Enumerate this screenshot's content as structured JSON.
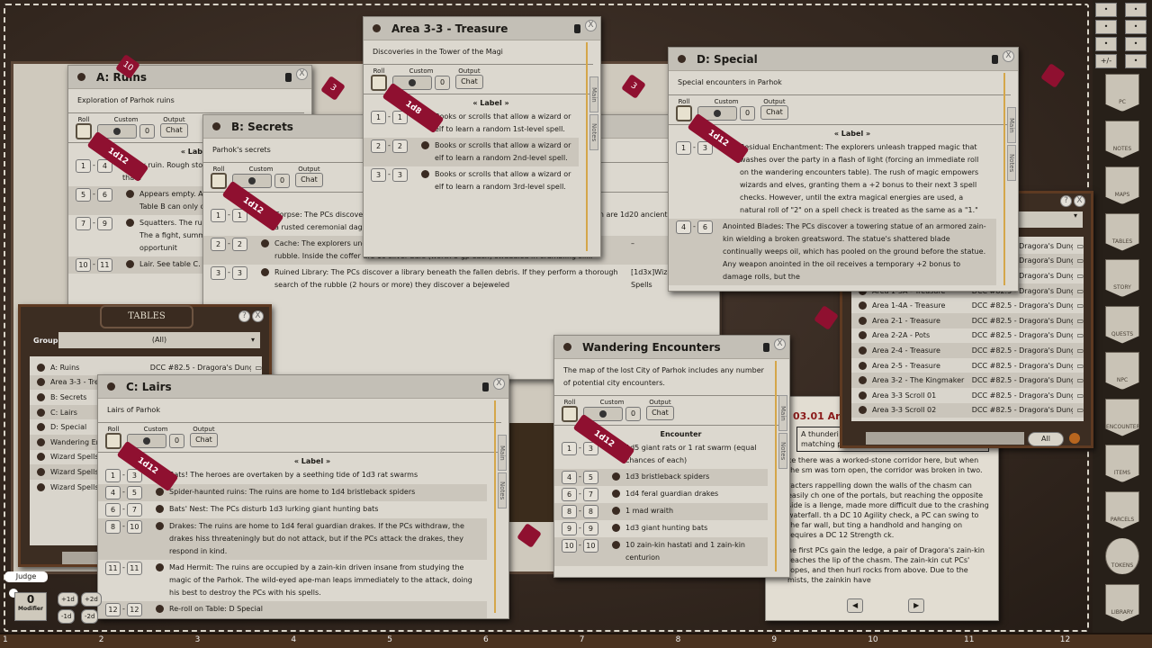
{
  "bottombar": {
    "ticks": [
      "1",
      "2",
      "3",
      "4",
      "5",
      "6",
      "7",
      "8",
      "9",
      "10",
      "11",
      "12"
    ]
  },
  "windows": [
    {
      "id": "a-ruins",
      "title": "A: Ruins",
      "subtitle": "Exploration of Parhok ruins",
      "roll": "Roll",
      "custom": "Custom",
      "custom_value": "0",
      "output": "Output",
      "output_value": "Chat",
      "dice": "1d12",
      "column": "« Label »",
      "tabs": [],
      "rows": [
        {
          "from": "1",
          "to": "4",
          "dot": false,
          "text": "Empty ruin. Rough stone and plaster are all that r"
        },
        {
          "from": "5",
          "to": "6",
          "dot": true,
          "text": "Appears empty. A c otherwise. See tabl Table B can only oc"
        },
        {
          "from": "7",
          "to": "9",
          "dot": true,
          "text": "Squatters. The ruin zain-kin hastati. The a fight, summoning the first opportunit"
        },
        {
          "from": "10",
          "to": "11",
          "dot": true,
          "text": "Lair. See table C."
        }
      ]
    },
    {
      "id": "b-secrets",
      "title": "B: Secrets",
      "subtitle": "Parhok's secrets",
      "roll": "Roll",
      "custom": "Custom",
      "custom_value": "0",
      "output": "Output",
      "output_value": "Chat",
      "dice": "1d12",
      "column": "Encounter",
      "tabs": [],
      "rows": [
        {
          "from": "1",
          "to": "1",
          "dot": true,
          "text": "Corpse: The PCs discover th of a Parhok enchanter. The tattered robes of its order. skeleton are 1d20 ancient g and a rusted ceremonial dagger."
        },
        {
          "from": "2",
          "to": "2",
          "dot": true,
          "text": "Cache: The explorers uncover a locked coffer (DC 15 Open Locks check) buried amid the rubble. Inside the coffer are 10 silver bars (worth 5 gp each) swaddled in crumbling silk.",
          "extra": "–"
        },
        {
          "from": "3",
          "to": "3",
          "dot": true,
          "text": "Ruined Library: The PCs discover a library beneath the fallen debris. If they perform a thorough search of the rubble (2 hours or more) they discover a bejeweled",
          "extra": "[1d3x]Wizard Spells"
        }
      ]
    },
    {
      "id": "area-3-3",
      "title": "Area 3-3 - Treasure",
      "subtitle": "Discoveries in the Tower of the Magi",
      "roll": "Roll",
      "custom": "Custom",
      "custom_value": "0",
      "output": "Output",
      "output_value": "Chat",
      "dice": "1d8",
      "column": "« Label »",
      "tabs": [
        "Main",
        "Notes"
      ],
      "rows": [
        {
          "from": "1",
          "to": "1",
          "dot": true,
          "text": "Books or scrolls that allow a wizard or elf to learn a random 1st-level spell."
        },
        {
          "from": "2",
          "to": "2",
          "dot": true,
          "text": "Books or scrolls that allow a wizard or elf to learn a random 2nd-level spell."
        },
        {
          "from": "3",
          "to": "3",
          "dot": true,
          "text": "Books or scrolls that allow a wizard or elf to learn a random 3rd-level spell."
        }
      ]
    },
    {
      "id": "d-special",
      "title": "D: Special",
      "subtitle": "Special encounters in Parhok",
      "roll": "Roll",
      "custom": "Custom",
      "custom_value": "0",
      "output": "Output",
      "output_value": "Chat",
      "dice": "1d12",
      "column": "« Label »",
      "tabs": [
        "Main",
        "Notes"
      ],
      "rows": [
        {
          "from": "1",
          "to": "3",
          "dot": true,
          "text": "Residual Enchantment: The explorers unleash trapped magic that washes over the party in a flash of light (forcing an immediate roll on the wandering encounters table). The rush of magic empowers wizards and elves, granting them a +2 bonus to their next 3 spell checks. However, until the extra magical energies are used, a natural roll of \"2\" on a spell check is treated as the same as a \"1.\""
        },
        {
          "from": "4",
          "to": "6",
          "dot": false,
          "text": "Anointed Blades: The PCs discover a towering statue of an armored zain-kin wielding a broken greatsword. The statue's shattered blade continually weeps oil, which has pooled on the ground before the statue. Any weapon anointed in the oil receives a temporary +2 bonus to damage rolls, but the"
        }
      ]
    },
    {
      "id": "c-lairs",
      "title": "C: Lairs",
      "subtitle": "Lairs of Parhok",
      "roll": "Roll",
      "custom": "Custom",
      "custom_value": "0",
      "output": "Output",
      "output_value": "Chat",
      "dice": "1d12",
      "column": "« Label »",
      "tabs": [
        "Main",
        "Notes"
      ],
      "rows": [
        {
          "from": "1",
          "to": "3",
          "dot": true,
          "text": "Rats! The heroes are overtaken by a seething tide of 1d3 rat swarms"
        },
        {
          "from": "4",
          "to": "5",
          "dot": true,
          "text": "Spider-haunted ruins: The ruins are home to 1d4 bristleback spiders"
        },
        {
          "from": "6",
          "to": "7",
          "dot": true,
          "text": "Bats' Nest: The PCs disturb 1d3 lurking giant hunting bats"
        },
        {
          "from": "8",
          "to": "10",
          "dot": true,
          "text": "Drakes: The ruins are home to 1d4 feral guardian drakes. If the PCs withdraw, the drakes hiss threateningly but do not attack, but if the PCs attack the drakes, they respond in kind."
        },
        {
          "from": "11",
          "to": "11",
          "dot": true,
          "text": "Mad Hermit: The ruins are occupied by a zain-kin driven insane from studying the magic of the Parhok. The wild-eyed ape-man leaps immediately to the attack, doing his best to destroy the PCs with his spells."
        },
        {
          "from": "12",
          "to": "12",
          "dot": true,
          "text": "Re-roll on Table: D Special"
        }
      ]
    },
    {
      "id": "wandering",
      "title": "Wandering Encounters",
      "subtitle": "The map of the lost City of Parhok includes any number of potential city encounters.",
      "roll": "Roll",
      "custom": "Custom",
      "custom_value": "0",
      "output": "Output",
      "output_value": "Chat",
      "dice": "1d12",
      "column": "Encounter",
      "tabs": [
        "Main",
        "Notes"
      ],
      "rows": [
        {
          "from": "1",
          "to": "3",
          "dot": true,
          "text": "1d5 giant rats or 1 rat swarm (equal chances of each)"
        },
        {
          "from": "4",
          "to": "5",
          "dot": true,
          "text": "1d3 bristleback spiders"
        },
        {
          "from": "6",
          "to": "7",
          "dot": true,
          "text": "1d4 feral guardian drakes"
        },
        {
          "from": "8",
          "to": "8",
          "dot": true,
          "text": "1 mad wraith"
        },
        {
          "from": "9",
          "to": "9",
          "dot": true,
          "text": "1d3 giant hunting bats"
        },
        {
          "from": "10",
          "to": "10",
          "dot": true,
          "text": "10 zain-kin hastati and 1 zain-kin centurion"
        }
      ]
    }
  ],
  "tables_panel": {
    "title": "TABLES",
    "group_label": "Group",
    "group_value": "(All)",
    "items": [
      {
        "name": "A: Ruins",
        "source": "DCC #82.5 - Dragora's Dungeon"
      },
      {
        "name": "Area 3-3 - Treasure",
        "source": ""
      },
      {
        "name": "B: Secrets",
        "source": ""
      },
      {
        "name": "C: Lairs",
        "source": ""
      },
      {
        "name": "D: Special",
        "source": ""
      },
      {
        "name": "Wandering Encounters",
        "source": ""
      },
      {
        "name": "Wizard Spells,",
        "source": ""
      },
      {
        "name": "Wizard Spells,",
        "source": ""
      },
      {
        "name": "Wizard Spells,",
        "source": ""
      }
    ]
  },
  "right_panel": {
    "filter_label": "All",
    "items": [
      {
        "name": "",
        "source": "DCC #82.5 - Dragora's Dungeon"
      },
      {
        "name": "",
        "source": "DCC #82.5 - Dragora's Dungeon"
      },
      {
        "name": "",
        "source": "DCC #82.5 - Dragora's Dungeon"
      },
      {
        "name": "Area 1-3A - Treasure",
        "source": "DCC #82.5 - Dragora's Dungeon"
      },
      {
        "name": "Area 1-4A - Treasure",
        "source": "DCC #82.5 - Dragora's Dungeon"
      },
      {
        "name": "Area 2-1 - Treasure",
        "source": "DCC #82.5 - Dragora's Dungeon"
      },
      {
        "name": "Area 2-2A - Pots",
        "source": "DCC #82.5 - Dragora's Dungeon"
      },
      {
        "name": "Area 2-4 - Treasure",
        "source": "DCC #82.5 - Dragora's Dungeon"
      },
      {
        "name": "Area 2-5 - Treasure",
        "source": "DCC #82.5 - Dragora's Dungeon"
      },
      {
        "name": "Area 3-2 - The Kingmaker",
        "source": "DCC #82.5 - Dragora's Dungeon"
      },
      {
        "name": "Area 3-3 Scroll 01",
        "source": "DCC #82.5 - Dragora's Dungeon"
      },
      {
        "name": "Area 3-3 Scroll 02",
        "source": "DCC #82.5 - Dragora's Dungeon"
      }
    ]
  },
  "story": {
    "title": "03.01 Ar",
    "boxed": "A thunderi tumbling d water crashes atop a pair of matching portals set into the wall of the chasm.",
    "paragraphs": [
      "ce there was a worked-stone corridor here, but when the sm was torn open, the corridor was broken in two.",
      "racters rappelling down the walls of the chasm can easily ch one of the portals, but reaching the opposite side is a llenge, made more difficult due to the crashing waterfall. th a DC 10 Agility check, a PC can swing to the far wall, but ting a handhold and hanging on requires a DC 12 Strength ck.",
      "he first PCs gain the ledge, a pair of Dragora's zain-kin reaches the lip of the chasm. The zain-kin cut PCs' ropes, and then hurl rocks from above. Due to the mists, the zainkin have"
    ]
  },
  "sidebar": {
    "tools": [
      "swords-icon",
      "party-icon",
      "dice-bag-icon",
      "mask-icon",
      "day-night-icon",
      "gear-icon",
      "+/-",
      "pointer-icon"
    ],
    "buttons": [
      "PC",
      "NOTES",
      "MAPS",
      "TABLES",
      "STORY",
      "QUESTS",
      "NPC",
      "ENCOUNTERS",
      "ITEMS",
      "PARCELS",
      "TOKENS",
      "LIBRARY"
    ]
  },
  "modifier": {
    "user": "Judge",
    "value": "0",
    "label": "Modifier",
    "dice_buttons": [
      "+1d",
      "+2d",
      "-1d",
      "-2d"
    ]
  },
  "dice": [
    "10",
    "3",
    "3",
    "",
    "",
    ""
  ],
  "colors": {
    "die": "#8f1030",
    "scroll": "#d4a64a",
    "leather": "#3a2c24"
  }
}
